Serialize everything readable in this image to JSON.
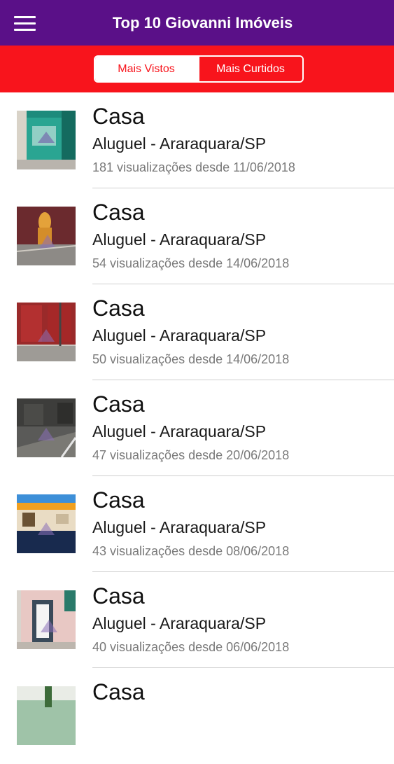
{
  "header": {
    "title": "Top 10 Giovanni Imóveis",
    "menu_icon": "hamburger-menu-icon"
  },
  "tabs": [
    {
      "label": "Mais Vistos",
      "selected": true
    },
    {
      "label": "Mais Curtidos",
      "selected": false
    }
  ],
  "colors": {
    "app_bar": "#5a1088",
    "tab_bar": "#f8141c",
    "accent": "#f8141c"
  },
  "listings": [
    {
      "type": "Casa",
      "location": "Aluguel - Araraquara/SP",
      "views": "181 visualizações desde 11/06/2018"
    },
    {
      "type": "Casa",
      "location": "Aluguel - Araraquara/SP",
      "views": "54 visualizações desde 14/06/2018"
    },
    {
      "type": "Casa",
      "location": "Aluguel - Araraquara/SP",
      "views": "50 visualizações desde 14/06/2018"
    },
    {
      "type": "Casa",
      "location": "Aluguel - Araraquara/SP",
      "views": "47 visualizações desde 20/06/2018"
    },
    {
      "type": "Casa",
      "location": "Aluguel - Araraquara/SP",
      "views": "43 visualizações desde 08/06/2018"
    },
    {
      "type": "Casa",
      "location": "Aluguel - Araraquara/SP",
      "views": "40 visualizações desde 06/06/2018"
    },
    {
      "type": "Casa",
      "location": "",
      "views": ""
    }
  ]
}
